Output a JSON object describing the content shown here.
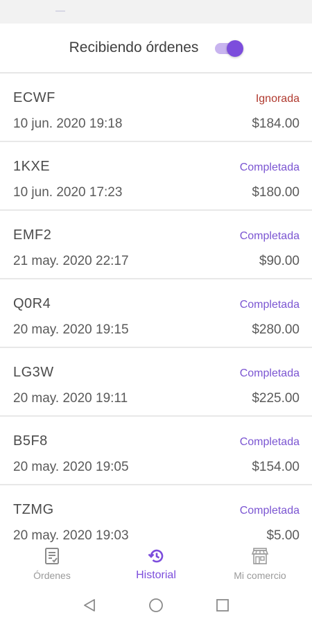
{
  "header": {
    "title": "Recibiendo órdenes",
    "toggle_on": true,
    "accent_color": "#7c4ddc"
  },
  "orders": [
    {
      "code": "ECWF",
      "date": "10 jun. 2020 19:18",
      "status": "Ignorada",
      "amount": "$184.00"
    },
    {
      "code": "1KXE",
      "date": "10 jun. 2020 17:23",
      "status": "Completada",
      "amount": "$180.00"
    },
    {
      "code": "EMF2",
      "date": "21 may. 2020 22:17",
      "status": "Completada",
      "amount": "$90.00"
    },
    {
      "code": "Q0R4",
      "date": "20 may. 2020 19:15",
      "status": "Completada",
      "amount": "$280.00"
    },
    {
      "code": "LG3W",
      "date": "20 may. 2020 19:11",
      "status": "Completada",
      "amount": "$225.00"
    },
    {
      "code": "B5F8",
      "date": "20 may. 2020 19:05",
      "status": "Completada",
      "amount": "$154.00"
    },
    {
      "code": "TZMG",
      "date": "20 may. 2020 19:03",
      "status": "Completada",
      "amount": "$5.00"
    }
  ],
  "status_colors": {
    "Ignorada": "#b0392e",
    "Completada": "#7b55d2"
  },
  "bottom_nav": {
    "items": [
      {
        "label": "Órdenes",
        "icon": "receipt-icon",
        "active": false
      },
      {
        "label": "Historial",
        "icon": "history-icon",
        "active": true
      },
      {
        "label": "Mi comercio",
        "icon": "store-icon",
        "active": false
      }
    ]
  },
  "system_nav": {
    "icons": [
      "back-icon",
      "home-icon",
      "recents-icon"
    ]
  }
}
